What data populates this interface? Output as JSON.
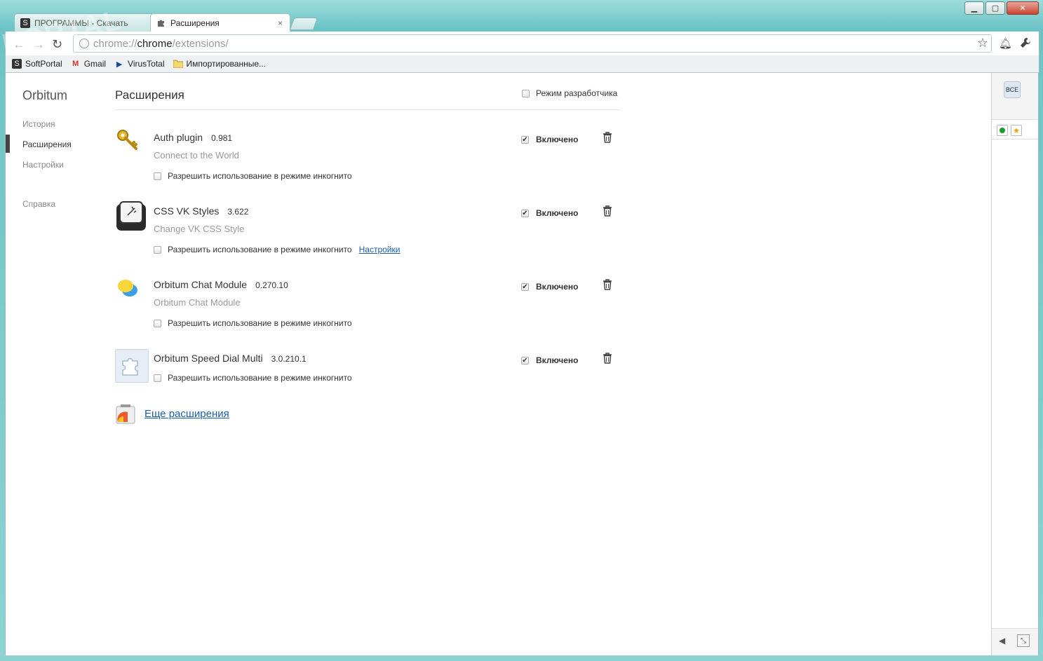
{
  "window": {
    "minimize": "▁",
    "maximize": "▢",
    "close": "✕"
  },
  "tabs": [
    {
      "label": "ПРОГРАММЫ - Скачать",
      "icon": "softportal-favicon"
    },
    {
      "label": "Расширения",
      "icon": "puzzle-icon",
      "close": "×"
    }
  ],
  "toolbar": {
    "url_scheme": "chrome://",
    "url_host": "chrome",
    "url_path": "/extensions/"
  },
  "bookmarks": [
    {
      "label": "SoftPortal",
      "icon": "softportal-icon"
    },
    {
      "label": "Gmail",
      "icon": "gmail-icon"
    },
    {
      "label": "VirusTotal",
      "icon": "virustotal-icon"
    },
    {
      "label": "Импортированные...",
      "icon": "folder-icon"
    }
  ],
  "sidebar": {
    "logo": "Orbitum",
    "items": [
      {
        "label": "История"
      },
      {
        "label": "Расширения"
      },
      {
        "label": "Настройки"
      },
      {
        "label": "Справка"
      }
    ]
  },
  "page": {
    "title": "Расширения",
    "dev_mode_label": "Режим разработчика"
  },
  "extensions": [
    {
      "name": "Auth plugin",
      "version": "0.981",
      "description": "Connect to the World",
      "incognito": "Разрешить использование в режиме инкогнито",
      "enabled": "Включено"
    },
    {
      "name": "CSS VK Styles",
      "version": "3.622",
      "description": "Change VK CSS Style",
      "incognito": "Разрешить использование в режиме инкогнито",
      "options": "Настройки",
      "enabled": "Включено"
    },
    {
      "name": "Orbitum Chat Module",
      "version": "0.270.10",
      "description": "Orbitum Chat Module",
      "incognito": "Разрешить использование в режиме инкогнито",
      "enabled": "Включено"
    },
    {
      "name": "Orbitum Speed Dial Multi",
      "version": "3.0.210.1",
      "incognito": "Разрешить использование в режиме инкогнито",
      "enabled": "Включено"
    }
  ],
  "more_link": "Еще расширения",
  "rightbar": {
    "all_label": "ВСЕ"
  },
  "watermark": "PORTAL"
}
